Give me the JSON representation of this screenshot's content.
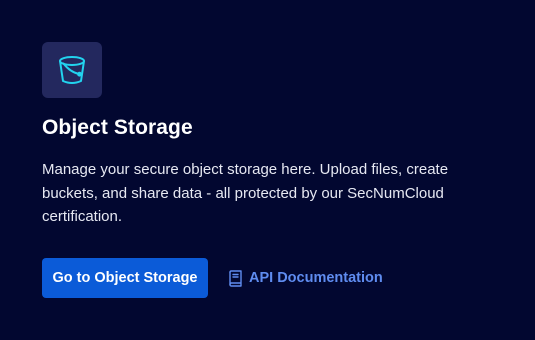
{
  "card": {
    "icon": "bucket-icon",
    "title": "Object Storage",
    "description": "Manage your secure object storage here. Upload files, create buckets, and share data - all protected by our SecNumCloud certification.",
    "primary_button_label": "Go to Object Storage",
    "doc_link_icon": "book-icon",
    "doc_link_label": "API Documentation"
  },
  "colors": {
    "background": "#020730",
    "icon_tile": "#23285e",
    "icon_accent": "#22d3ee",
    "primary_button": "#0b5bd8",
    "link": "#5f8cf0"
  }
}
